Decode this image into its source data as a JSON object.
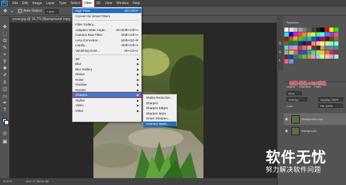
{
  "app": {
    "logo": "Ps"
  },
  "menubar": [
    "File",
    "Edit",
    "Image",
    "Layer",
    "Type",
    "Select",
    "Filter",
    "3D",
    "View",
    "Window",
    "Help"
  ],
  "options": {
    "auto_select_label": "Auto-Select:",
    "auto_select_value": "Layer"
  },
  "document_tab": "yezai.jpg @ 16.7% (Background copy, RGB/8)",
  "status": {
    "zoom": "16.67%",
    "doc": "Doc: 17.2M/34.4M"
  },
  "filter_menu": {
    "top": [
      {
        "label": "High Pass",
        "shortcut": "Alt+Ctrl+F"
      },
      {
        "label": "Convert for Smart Filters",
        "shortcut": ""
      }
    ],
    "middle": [
      {
        "label": "Filter Gallery...",
        "shortcut": ""
      },
      {
        "label": "Adaptive Wide Angle...",
        "shortcut": "Alt+Shift+Ctrl+A"
      },
      {
        "label": "Camera Raw Filter...",
        "shortcut": "Shift+Ctrl+A"
      },
      {
        "label": "Lens Correction...",
        "shortcut": "Shift+Ctrl+R"
      },
      {
        "label": "Liquify...",
        "shortcut": "Shift+Ctrl+X"
      },
      {
        "label": "Vanishing Point...",
        "shortcut": "Alt+Ctrl+V"
      }
    ],
    "groups": [
      "3D",
      "Blur",
      "Blur Gallery",
      "Distort",
      "Noise",
      "Pixelate",
      "Render",
      "Sharpen",
      "Stylize",
      "Video",
      "Other"
    ]
  },
  "sharpen_menu": [
    "Shake Reduction...",
    "Sharpen",
    "Sharpen Edges",
    "Sharpen More",
    "Smart Sharpen...",
    "Unsharp Mask..."
  ],
  "panels": {
    "swatches_tab": "Swatches",
    "layers_tabs": [
      "Layers",
      "Channels",
      "Paths"
    ],
    "kind_filter": "Kind",
    "blend_mode": "Overlay",
    "opacity": "Opacity: 100%",
    "lock": "Lock:",
    "fill": "Fill: 100%",
    "layers": [
      {
        "name": "Background copy",
        "selected": true
      },
      {
        "name": "Background",
        "selected": false
      }
    ]
  },
  "annotation": "滤镜-锐化-USM锐化",
  "watermark": {
    "main": "软件无忧",
    "sub": "努力解决软件问题"
  },
  "colors": {
    "menu_highlight": "#1f6fc5",
    "annotation_red": "#e3242b",
    "foreground": "#7ec0d8",
    "swatches": [
      "#ffffff",
      "#e0e0e0",
      "#c0c0c0",
      "#a0a0a0",
      "#808080",
      "#606060",
      "#404040",
      "#202020",
      "#000000",
      "#ff0000",
      "#ffff00",
      "#00ff00",
      "#00ffff",
      "#0000ff",
      "#ff00ff",
      "#ff4040",
      "#ff8040",
      "#ffc040",
      "#c0ff40",
      "#40ff80",
      "#40ffff",
      "#4080ff",
      "#8040ff",
      "#ff40c0",
      "#c00000",
      "#c06000",
      "#c0c000",
      "#60c000",
      "#00c060",
      "#00c0c0",
      "#0060c0",
      "#6000c0",
      "#c00060",
      "#800000",
      "#804000",
      "#808000",
      "#408000",
      "#008040",
      "#008080",
      "#004080",
      "#400080",
      "#800040",
      "#ff8080",
      "#ffc080",
      "#ffff80",
      "#c0ff80",
      "#80ffc0",
      "#80ffff",
      "#80c0ff",
      "#c080ff",
      "#ff80c0",
      "#a05030",
      "#d08050",
      "#e0b080",
      "#604030",
      "#403020",
      "#c0a080",
      "#8070a0",
      "#5090b0",
      "#30a070",
      "#90c040",
      "#d0d040",
      "#e06060",
      "#7030a0",
      "#3050d0",
      "#20a0c0",
      "#50d090",
      "#b0e050",
      "#f0c030",
      "#f07030",
      "#d03030",
      "#a02070",
      "#602090",
      "#2040a0",
      "#208090",
      "#30a050",
      "#80b030",
      "#c0a030",
      "#ff9999",
      "#99ccff",
      "#ccff99",
      "#ffcc99",
      "#cc99ff",
      "#99ffcc",
      "#ff6666",
      "#6699ff"
    ]
  }
}
